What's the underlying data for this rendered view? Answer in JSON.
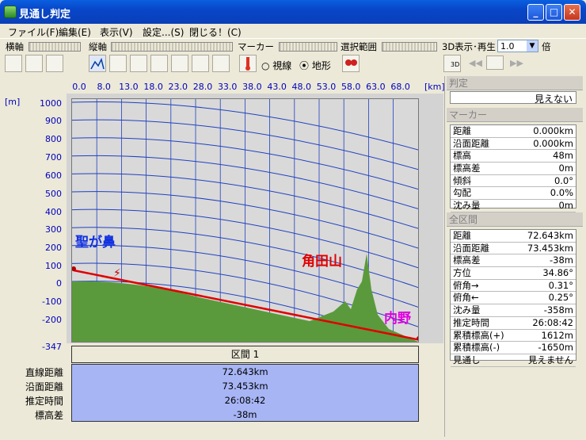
{
  "window": {
    "title": "見通し判定"
  },
  "menu": [
    "ファイル(F)",
    "編集(E)",
    "表示(V)",
    "設定...(S)",
    "閉じる！(C)"
  ],
  "toolbar": {
    "horizontal_axis": "横軸",
    "vertical_axis": "縦軸",
    "marker": "マーカー",
    "range": "選択範囲",
    "display3d": "3D表示･再生",
    "speed_value": "1.0",
    "speed_unit": "倍",
    "radio_sightline": "視線",
    "radio_terrain": "地形",
    "icon_3d": "3D"
  },
  "plot": {
    "x_unit": "[km]",
    "y_unit": "[m]",
    "x_ticks": [
      "0.0",
      "8.0",
      "13.0",
      "18.0",
      "23.0",
      "28.0",
      "33.0",
      "38.0",
      "43.0",
      "48.0",
      "53.0",
      "58.0",
      "63.0",
      "68.0"
    ],
    "y_ticks": [
      "1000",
      "900",
      "800",
      "700",
      "600",
      "500",
      "400",
      "300",
      "200",
      "100",
      "0",
      "-100",
      "-200",
      "-347"
    ],
    "labels": {
      "start": "聖が鼻",
      "mountain": "角田山",
      "end": "内野"
    }
  },
  "section": {
    "header": "区間 1",
    "rows": [
      {
        "label": "直線距離",
        "value": "72.643km"
      },
      {
        "label": "沿面距離",
        "value": "73.453km"
      },
      {
        "label": "推定時間",
        "value": "26:08:42"
      },
      {
        "label": "標高差",
        "value": "-38m"
      }
    ]
  },
  "judgement": {
    "header": "判定",
    "value": "見えない"
  },
  "marker_panel": {
    "header": "マーカー",
    "rows": [
      {
        "k": "距離",
        "v": "0.000km"
      },
      {
        "k": "沿面距離",
        "v": "0.000km"
      },
      {
        "k": "標高",
        "v": "48m"
      },
      {
        "k": "標高差",
        "v": "0m"
      },
      {
        "k": "傾斜",
        "v": "0.0°"
      },
      {
        "k": "勾配",
        "v": "0.0%"
      },
      {
        "k": "沈み量",
        "v": "0m"
      }
    ]
  },
  "total_panel": {
    "header": "全区間",
    "rows": [
      {
        "k": "距離",
        "v": "72.643km"
      },
      {
        "k": "沿面距離",
        "v": "73.453km"
      },
      {
        "k": "標高差",
        "v": "-38m"
      },
      {
        "k": "方位",
        "v": "34.86°"
      },
      {
        "k": "俯角→",
        "v": "0.31°"
      },
      {
        "k": "俯角←",
        "v": "0.25°"
      },
      {
        "k": "沈み量",
        "v": "-358m"
      },
      {
        "k": "推定時間",
        "v": "26:08:42"
      },
      {
        "k": "累積標高(+)",
        "v": "1612m"
      },
      {
        "k": "累積標高(-)",
        "v": "-1650m"
      },
      {
        "k": "見通し",
        "v": "見えません"
      }
    ]
  },
  "colors": {
    "terrain": "#5a9a3c",
    "sightline": "#e00000",
    "grid": "#2040c0"
  }
}
